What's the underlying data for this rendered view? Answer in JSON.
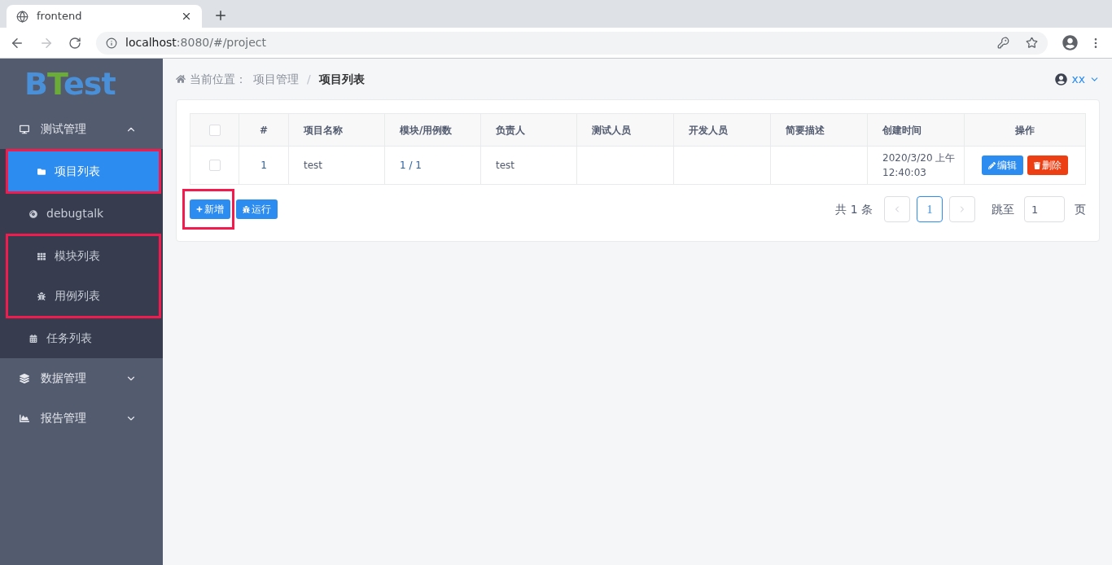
{
  "browser": {
    "tab_title": "frontend",
    "url_host": "localhost",
    "url_path": ":8080/#/project"
  },
  "sidebar": {
    "logo": [
      "B",
      "T",
      "est"
    ],
    "menus": [
      {
        "label": "测试管理",
        "expanded": true,
        "children": [
          {
            "label": "项目列表",
            "selected": true,
            "marked": true
          },
          {
            "label": "debugtalk",
            "selected": false,
            "marked": false
          },
          {
            "label": "模块列表",
            "selected": false,
            "marked": true
          },
          {
            "label": "用例列表",
            "selected": false,
            "marked": true
          },
          {
            "label": "任务列表",
            "selected": false,
            "marked": false
          }
        ]
      },
      {
        "label": "数据管理",
        "expanded": false
      },
      {
        "label": "报告管理",
        "expanded": false
      }
    ]
  },
  "breadcrumb": {
    "prefix": "当前位置：",
    "separator": "/",
    "items": [
      "项目管理",
      "项目列表"
    ]
  },
  "user": {
    "name": "xx"
  },
  "table": {
    "all_checked": false,
    "columns": [
      "#",
      "项目名称",
      "模块/用例数",
      "负责人",
      "测试人员",
      "开发人员",
      "简要描述",
      "创建时间",
      "操作"
    ],
    "rows": [
      {
        "checked": false,
        "cells": [
          "1",
          "test",
          "1 / 1",
          "test",
          "",
          "",
          "",
          "2020/3/20 上午 12:40:03"
        ],
        "actions": [
          "编辑",
          "删除"
        ]
      }
    ]
  },
  "toolbar": [
    {
      "label": "新增",
      "marked": true
    },
    {
      "label": "运行",
      "marked": false
    }
  ],
  "pagination": {
    "total": "共 1 条",
    "pages": [
      {
        "label": "1",
        "selected": true
      }
    ],
    "jump_label": "跳至",
    "jump_value": "1",
    "suffix": "页"
  }
}
